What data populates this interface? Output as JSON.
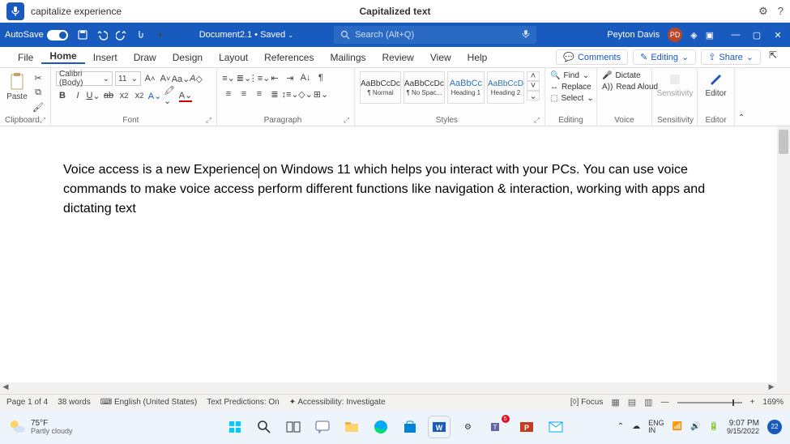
{
  "voiceBar": {
    "command": "capitalize experience",
    "status": "Capitalized text"
  },
  "titleBar": {
    "autosave": "AutoSave",
    "docName": "Document2.1 • Saved",
    "searchPlaceholder": "Search (Alt+Q)",
    "userName": "Peyton Davis",
    "userInitials": "PD"
  },
  "tabs": {
    "items": [
      "File",
      "Home",
      "Insert",
      "Draw",
      "Design",
      "Layout",
      "References",
      "Mailings",
      "Review",
      "View",
      "Help"
    ],
    "activeIndex": 1,
    "comments": "Comments",
    "editing": "Editing",
    "share": "Share"
  },
  "ribbon": {
    "clipboard": {
      "paste": "Paste",
      "label": "Clipboard"
    },
    "font": {
      "name": "Calibri (Body)",
      "size": "11",
      "label": "Font"
    },
    "paragraph": {
      "label": "Paragraph"
    },
    "styles": {
      "label": "Styles",
      "items": [
        {
          "preview": "AaBbCcDc",
          "name": "¶ Normal"
        },
        {
          "preview": "AaBbCcDc",
          "name": "¶ No Spac..."
        },
        {
          "preview": "AaBbCc",
          "name": "Heading 1"
        },
        {
          "preview": "AaBbCcD",
          "name": "Heading 2"
        }
      ]
    },
    "editing": {
      "find": "Find",
      "replace": "Replace",
      "select": "Select",
      "label": "Editing"
    },
    "voice": {
      "dictate": "Dictate",
      "readAloud": "Read Aloud",
      "label": "Voice"
    },
    "sensitivity": {
      "btn": "Sensitivity",
      "label": "Sensitivity"
    },
    "editor": {
      "btn": "Editor",
      "label": "Editor"
    }
  },
  "document": {
    "pre": "Voice access is a new Experience",
    "post": " on Windows 11 which helps you interact with your PCs. You can use voice commands to make voice access perform different functions like navigation & interaction, working with apps and dictating text"
  },
  "statusBar": {
    "page": "Page 1 of 4",
    "words": "38 words",
    "lang": "English (United States)",
    "predictions": "Text Predictions: On",
    "accessibility": "Accessibility: Investigate",
    "focus": "Focus",
    "zoom": "169%"
  },
  "taskbar": {
    "temp": "75°F",
    "weather": "Partly cloudy",
    "ime": "ENG\nIN",
    "time": "9:07 PM",
    "date": "9/15/2022",
    "notif": "22"
  }
}
